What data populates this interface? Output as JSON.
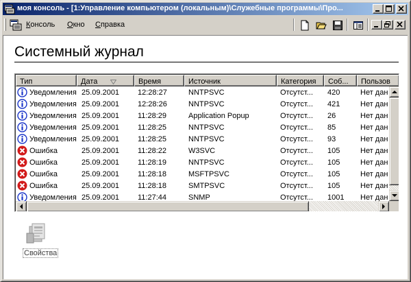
{
  "window": {
    "title": "моя консоль - [1:Управление компьютером (локальным)\\Служебные программы\\Про..."
  },
  "menu": {
    "items": [
      {
        "label": "Консоль",
        "accel": "К",
        "rest": "онсоль"
      },
      {
        "label": "Окно",
        "accel": "О",
        "rest": "кно"
      },
      {
        "label": "Справка",
        "accel": "С",
        "rest": "правка"
      }
    ]
  },
  "page": {
    "heading": "Системный журнал"
  },
  "columns": [
    "Тип",
    "Дата",
    "Время",
    "Источник",
    "Категория",
    "Соб...",
    "Пользов"
  ],
  "sort_column": "Дата",
  "rows": [
    {
      "type": "info",
      "cells": [
        "Уведомления",
        "25.09.2001",
        "12:28:27",
        "NNTPSVC",
        "Отсутст...",
        "420",
        "Нет дан"
      ]
    },
    {
      "type": "info",
      "cells": [
        "Уведомления",
        "25.09.2001",
        "12:28:26",
        "NNTPSVC",
        "Отсутст...",
        "421",
        "Нет дан"
      ]
    },
    {
      "type": "info",
      "cells": [
        "Уведомления",
        "25.09.2001",
        "11:28:29",
        "Application Popup",
        "Отсутст...",
        "26",
        "Нет дан"
      ]
    },
    {
      "type": "info",
      "cells": [
        "Уведомления",
        "25.09.2001",
        "11:28:25",
        "NNTPSVC",
        "Отсутст...",
        "85",
        "Нет дан"
      ]
    },
    {
      "type": "info",
      "cells": [
        "Уведомления",
        "25.09.2001",
        "11:28:25",
        "NNTPSVC",
        "Отсутст...",
        "93",
        "Нет дан"
      ]
    },
    {
      "type": "error",
      "cells": [
        "Ошибка",
        "25.09.2001",
        "11:28:22",
        "W3SVC",
        "Отсутст...",
        "105",
        "Нет дан"
      ]
    },
    {
      "type": "error",
      "cells": [
        "Ошибка",
        "25.09.2001",
        "11:28:19",
        "NNTPSVC",
        "Отсутст...",
        "105",
        "Нет дан"
      ]
    },
    {
      "type": "error",
      "cells": [
        "Ошибка",
        "25.09.2001",
        "11:28:18",
        "MSFTPSVC",
        "Отсутст...",
        "105",
        "Нет дан"
      ]
    },
    {
      "type": "error",
      "cells": [
        "Ошибка",
        "25.09.2001",
        "11:28:18",
        "SMTPSVC",
        "Отсутст...",
        "105",
        "Нет дан"
      ]
    },
    {
      "type": "info",
      "cells": [
        "Уведомления",
        "25.09.2001",
        "11:27:44",
        "SNMP",
        "Отсутст...",
        "1001",
        "Нет дан"
      ]
    }
  ],
  "task": {
    "label": "Свойства"
  },
  "colors": {
    "title_start": "#0a246a",
    "title_end": "#a6caf0",
    "info": "#1a35c9",
    "error": "#d21a1a"
  }
}
